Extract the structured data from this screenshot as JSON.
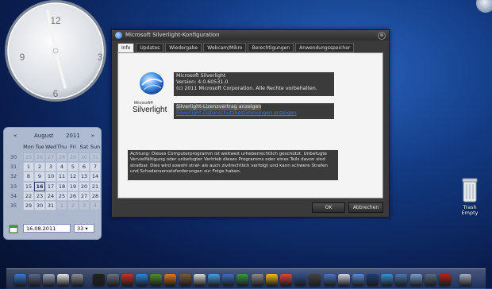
{
  "clock": {
    "numerals": [
      "12",
      "3",
      "6",
      "9"
    ],
    "time": "12:31"
  },
  "calendar": {
    "month": "August",
    "year": "2011",
    "prev": "«",
    "next": "»",
    "weekdays": [
      "Mon",
      "Tue",
      "Wed",
      "Thu",
      "Fri",
      "Sat",
      "Sun"
    ],
    "week_numbers": [
      "30",
      "31",
      "32",
      "33",
      "34",
      "35"
    ],
    "days": [
      "25",
      "26",
      "27",
      "28",
      "29",
      "30",
      "31",
      "1",
      "2",
      "3",
      "4",
      "5",
      "6",
      "7",
      "8",
      "9",
      "10",
      "11",
      "12",
      "13",
      "14",
      "15",
      "16",
      "17",
      "18",
      "19",
      "20",
      "21",
      "22",
      "23",
      "24",
      "25",
      "26",
      "27",
      "28",
      "29",
      "30",
      "31",
      "1",
      "2",
      "3",
      "4"
    ],
    "date_value": "16.08.2011",
    "week_select": "33"
  },
  "window": {
    "title": "Microsoft Silverlight-Konfiguration",
    "close_glyph": "⊗",
    "tabs": [
      "Info",
      "Updates",
      "Wiedergabe",
      "Webcam/Mikro",
      "Berechtigungen",
      "Anwendungsspeicher"
    ],
    "active_tab": 0,
    "logo_text": "Silverlight",
    "logo_prefix": "Microsoft®",
    "info_lines": [
      "Microsoft Silverlight",
      "Version: 4.0.60531.0",
      "(c) 2011 Microsoft Corporation. Alle Rechte vorbehalten."
    ],
    "license_link": "Silverlight-Lizenzvertrag anzeigen",
    "privacy_link": "Silverlight-Datenschutzbestimmungen anzeigen",
    "warning": "Achtung: Dieses Computerprogramm ist weltweit urheberrechtlich geschützt. Unbefugte Vervielfältigung oder unbefugter Vertrieb dieses Programms oder eines Teils davon sind strafbar. Dies wird sowohl straf- als auch zivilrechtlich verfolgt und kann schwere Strafen und Schadensersatzforderungen zur Folge haben.",
    "ok_label": "OK",
    "cancel_label": "Abbrechen"
  },
  "trash": {
    "line1": "Trash",
    "line2": "Empty"
  },
  "dock": {
    "icons": [
      {
        "name": "finder-globe-icon",
        "color": "#3a78d8"
      },
      {
        "name": "network-icon",
        "color": "#5a6a88"
      },
      {
        "name": "mail-icon",
        "color": "#9aa6bb"
      },
      {
        "name": "calendar-icon",
        "color": "#e8e8e8"
      },
      {
        "name": "preferences-icon",
        "color": "#8a8f99"
      },
      {
        "name": "terminal-icon",
        "color": "#222222"
      },
      {
        "name": "photo-icon",
        "color": "#6b7380"
      },
      {
        "name": "opera-icon",
        "color": "#c83030"
      },
      {
        "name": "ie-icon",
        "color": "#2e86de"
      },
      {
        "name": "games-icon",
        "color": "#4f8f2f"
      },
      {
        "name": "firefox-icon",
        "color": "#e07a1f"
      },
      {
        "name": "gimp-icon",
        "color": "#7b5a3c"
      },
      {
        "name": "chess-icon",
        "color": "#dddddd"
      },
      {
        "name": "itunes-icon",
        "color": "#4aa0e6"
      },
      {
        "name": "quicktime-icon",
        "color": "#3c6fc2"
      },
      {
        "name": "video-icon",
        "color": "#3a9a46"
      },
      {
        "name": "frame-icon",
        "color": "#8c8c8c"
      },
      {
        "name": "duck-icon",
        "color": "#f2c21a"
      },
      {
        "name": "chrome-icon",
        "color": "#d94a3a"
      },
      {
        "name": "recorder-icon",
        "color": "#2f4f8f"
      },
      {
        "name": "spy-icon",
        "color": "#444444"
      },
      {
        "name": "thunderbird-icon",
        "color": "#4a76c0"
      },
      {
        "name": "stamp-icon",
        "color": "#d0d8e6"
      },
      {
        "name": "folder-icon",
        "color": "#5c8ed6"
      },
      {
        "name": "photoshop-icon",
        "color": "#1c3f7a"
      },
      {
        "name": "safari-icon",
        "color": "#3b8fd9"
      },
      {
        "name": "network-globe-icon",
        "color": "#4c79b0"
      },
      {
        "name": "utility-icon",
        "color": "#7aa0d0"
      },
      {
        "name": "monitor-icon",
        "color": "#5b6b7f"
      },
      {
        "name": "reader-icon",
        "color": "#b42020"
      },
      {
        "name": "stack-icon",
        "color": "#a5b0c2"
      }
    ]
  }
}
